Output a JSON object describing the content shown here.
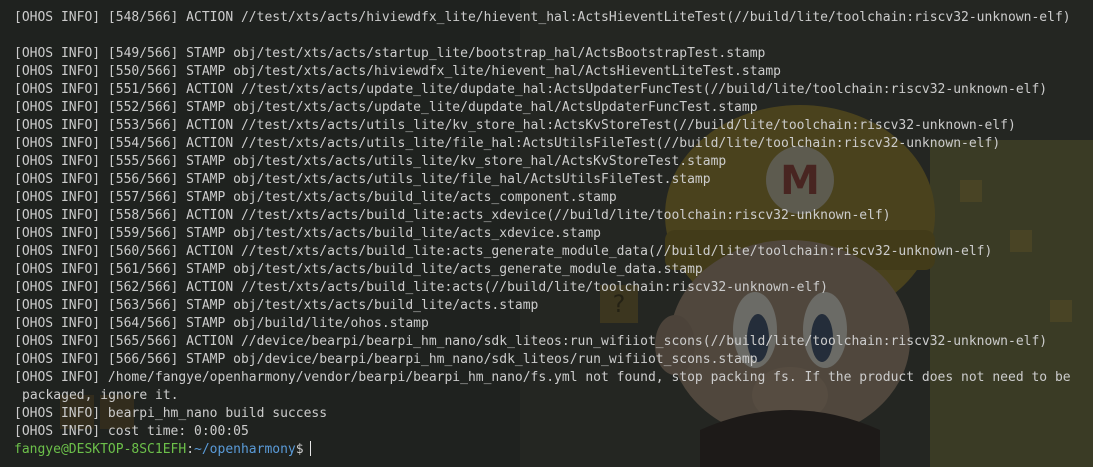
{
  "terminal": {
    "lines": [
      "[OHOS INFO] [548/566] ACTION //test/xts/acts/hiviewdfx_lite/hievent_hal:ActsHieventLiteTest(//build/lite/toolchain:riscv32-unknown-elf)",
      "",
      "[OHOS INFO] [549/566] STAMP obj/test/xts/acts/startup_lite/bootstrap_hal/ActsBootstrapTest.stamp",
      "[OHOS INFO] [550/566] STAMP obj/test/xts/acts/hiviewdfx_lite/hievent_hal/ActsHieventLiteTest.stamp",
      "[OHOS INFO] [551/566] ACTION //test/xts/acts/update_lite/dupdate_hal:ActsUpdaterFuncTest(//build/lite/toolchain:riscv32-unknown-elf)",
      "[OHOS INFO] [552/566] STAMP obj/test/xts/acts/update_lite/dupdate_hal/ActsUpdaterFuncTest.stamp",
      "[OHOS INFO] [553/566] ACTION //test/xts/acts/utils_lite/kv_store_hal:ActsKvStoreTest(//build/lite/toolchain:riscv32-unknown-elf)",
      "[OHOS INFO] [554/566] ACTION //test/xts/acts/utils_lite/file_hal:ActsUtilsFileTest(//build/lite/toolchain:riscv32-unknown-elf)",
      "[OHOS INFO] [555/566] STAMP obj/test/xts/acts/utils_lite/kv_store_hal/ActsKvStoreTest.stamp",
      "[OHOS INFO] [556/566] STAMP obj/test/xts/acts/utils_lite/file_hal/ActsUtilsFileTest.stamp",
      "[OHOS INFO] [557/566] STAMP obj/test/xts/acts/build_lite/acts_component.stamp",
      "[OHOS INFO] [558/566] ACTION //test/xts/acts/build_lite:acts_xdevice(//build/lite/toolchain:riscv32-unknown-elf)",
      "[OHOS INFO] [559/566] STAMP obj/test/xts/acts/build_lite/acts_xdevice.stamp",
      "[OHOS INFO] [560/566] ACTION //test/xts/acts/build_lite:acts_generate_module_data(//build/lite/toolchain:riscv32-unknown-elf)",
      "[OHOS INFO] [561/566] STAMP obj/test/xts/acts/build_lite/acts_generate_module_data.stamp",
      "[OHOS INFO] [562/566] ACTION //test/xts/acts/build_lite:acts(//build/lite/toolchain:riscv32-unknown-elf)",
      "[OHOS INFO] [563/566] STAMP obj/test/xts/acts/build_lite/acts.stamp",
      "[OHOS INFO] [564/566] STAMP obj/build/lite/ohos.stamp",
      "[OHOS INFO] [565/566] ACTION //device/bearpi/bearpi_hm_nano/sdk_liteos:run_wifiiot_scons(//build/lite/toolchain:riscv32-unknown-elf)",
      "[OHOS INFO] [566/566] STAMP obj/device/bearpi/bearpi_hm_nano/sdk_liteos/run_wifiiot_scons.stamp",
      "[OHOS INFO] /home/fangye/openharmony/vendor/bearpi/bearpi_hm_nano/fs.yml not found, stop packing fs. If the product does not need to be",
      "packaged, ignore it.",
      "[OHOS INFO] bearpi_hm_nano build success",
      "[OHOS INFO] cost time: 0:00:05"
    ],
    "continuation_index": 21,
    "prompt": {
      "user_host": "fangye@DESKTOP-8SC1EFH",
      "separator": ":",
      "path": "~/openharmony",
      "symbol": "$"
    }
  },
  "colors": {
    "text": "#cccccc",
    "prompt_user": "#6cc04a",
    "prompt_path": "#5a9bd8",
    "background": "#2a2c2a"
  },
  "wallpaper": {
    "icon": "mario-builder-wallpaper"
  }
}
